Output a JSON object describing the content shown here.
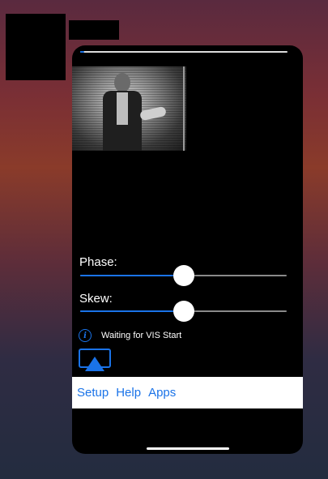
{
  "phase": {
    "label": "Phase:",
    "value": 0.5
  },
  "skew": {
    "label": "Skew:",
    "value": 0.5
  },
  "status": {
    "text": "Waiting for VIS Start"
  },
  "progress": {
    "value": 0.02
  },
  "bottom_nav": {
    "setup": "Setup",
    "help": "Help",
    "apps": "Apps"
  },
  "colors": {
    "accent": "#1a73e8",
    "panel_bg": "#000000",
    "bar_bg": "#ffffff"
  },
  "icons": [
    "info-icon",
    "airplay-icon"
  ]
}
